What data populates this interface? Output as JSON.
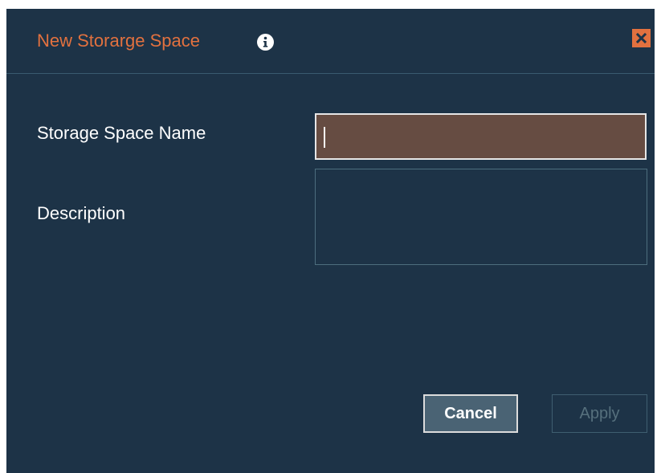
{
  "dialog": {
    "title": "New Storarge Space",
    "info_icon": "info-icon",
    "close_icon": "close-icon"
  },
  "form": {
    "name_label": "Storage Space Name",
    "name_value": "",
    "description_label": "Description",
    "description_value": ""
  },
  "buttons": {
    "cancel": "Cancel",
    "apply": "Apply",
    "apply_disabled": true
  },
  "colors": {
    "dialog_background": "#1d3347",
    "accent": "#e2713f",
    "name_input_background": "#664c42",
    "label_text": "#ffffff",
    "disabled_text": "#56707d"
  }
}
